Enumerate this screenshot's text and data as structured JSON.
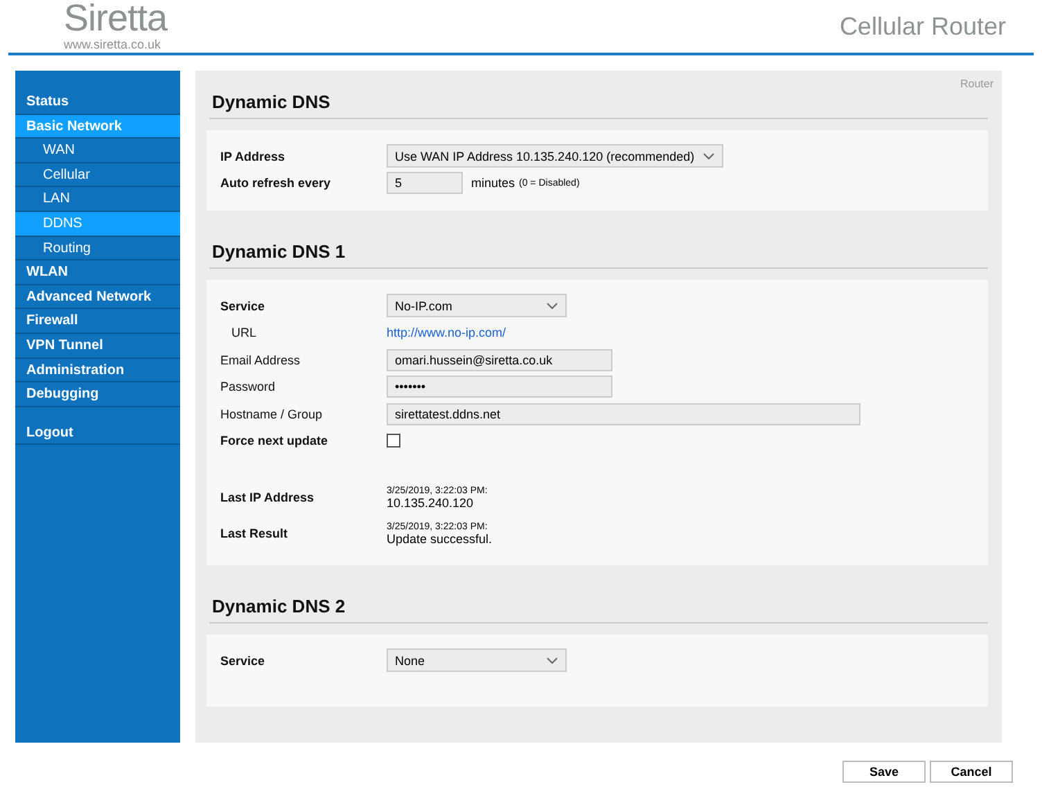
{
  "header": {
    "logo": "Siretta",
    "logo_url": "www.siretta.co.uk",
    "title": "Cellular Router"
  },
  "sidebar": {
    "items": [
      {
        "label": "Status",
        "selected": false
      },
      {
        "label": "Basic Network",
        "selected": true,
        "children": [
          {
            "label": "WAN",
            "selected": false
          },
          {
            "label": "Cellular",
            "selected": false
          },
          {
            "label": "LAN",
            "selected": false
          },
          {
            "label": "DDNS",
            "selected": true
          },
          {
            "label": "Routing",
            "selected": false
          }
        ]
      },
      {
        "label": "WLAN",
        "selected": false
      },
      {
        "label": "Advanced Network",
        "selected": false
      },
      {
        "label": "Firewall",
        "selected": false
      },
      {
        "label": "VPN Tunnel",
        "selected": false
      },
      {
        "label": "Administration",
        "selected": false
      },
      {
        "label": "Debugging",
        "selected": false
      }
    ],
    "logout": {
      "label": "Logout"
    }
  },
  "breadcrumb": "Router",
  "sections": [
    {
      "title": "Dynamic DNS",
      "rows": [
        {
          "kind": "select",
          "label": "IP Address",
          "bold": true,
          "value": "Use WAN IP Address 10.135.240.120 (recommended)"
        },
        {
          "kind": "number",
          "label": "Auto refresh every",
          "bold": true,
          "value": "5",
          "unit": "minutes",
          "note": "(0 = Disabled)"
        }
      ]
    },
    {
      "title": "Dynamic DNS 1",
      "rows": [
        {
          "kind": "select",
          "label": "Service",
          "bold": true,
          "value": "No-IP.com"
        },
        {
          "kind": "link",
          "label": "URL",
          "bold": false,
          "value": "http://www.no-ip.com/"
        },
        {
          "kind": "text",
          "label": "Email Address",
          "bold": false,
          "value": "omari.hussein@siretta.co.uk"
        },
        {
          "kind": "password",
          "label": "Password",
          "bold": false,
          "value": "•••••••"
        },
        {
          "kind": "wide_text",
          "label": "Hostname / Group",
          "bold": false,
          "value": "sirettatest.ddns.net"
        },
        {
          "kind": "checkbox",
          "label": "Force next update",
          "bold": true,
          "checked": false
        },
        {
          "kind": "status",
          "label": "Last IP Address",
          "bold": true,
          "time": "3/25/2019, 3:22:03 PM:",
          "value": "10.135.240.120"
        },
        {
          "kind": "status",
          "label": "Last Result",
          "bold": true,
          "time": "3/25/2019, 3:22:03 PM:",
          "value": "Update successful."
        }
      ]
    },
    {
      "title": "Dynamic DNS 2",
      "rows": [
        {
          "kind": "select",
          "label": "Service",
          "bold": true,
          "value": "None"
        }
      ]
    }
  ],
  "buttons": [
    {
      "label": "Save"
    },
    {
      "label": "Cancel"
    }
  ]
}
